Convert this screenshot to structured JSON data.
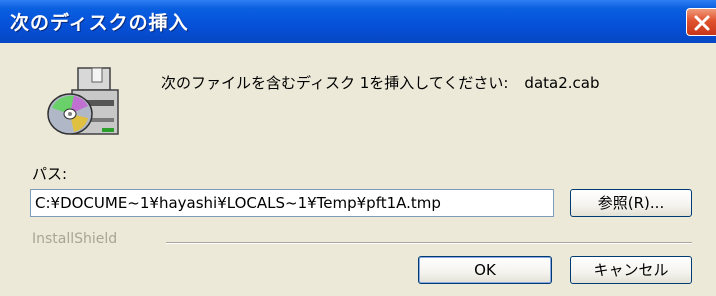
{
  "window": {
    "title": "次のディスクの挿入"
  },
  "message": {
    "prompt": "次のファイルを含むディスク 1を挿入してください:",
    "filename": "data2.cab"
  },
  "path": {
    "label": "パス:",
    "value": "C:¥DOCUME~1¥hayashi¥LOCALS~1¥Temp¥pft1A.tmp"
  },
  "buttons": {
    "browse": "参照(R)...",
    "ok": "OK",
    "cancel": "キャンセル"
  },
  "footer": {
    "brand": "InstallShield"
  },
  "colors": {
    "titlebar": "#0550d8",
    "close": "#e0532f",
    "dialog_bg": "#ece9d8"
  },
  "icons": {
    "dialog": "disk-insert-icon",
    "close": "close-icon"
  }
}
